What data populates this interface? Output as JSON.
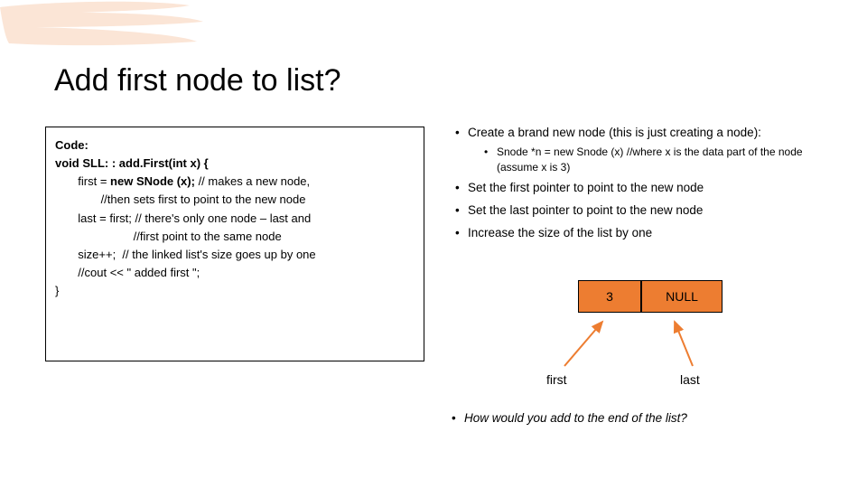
{
  "title": "Add first node to list?",
  "code": {
    "label": "Code:",
    "l1_a": "void SLL: : add.First(int x) {",
    "l2_a": "       first = ",
    "l2_b": "new SNode (x);",
    "l2_c": " // makes a new node,",
    "l3": "              //then sets first to point to the new node",
    "l4": "       last = first; // there's only one node – last and",
    "l5": "                        //first point to the same node",
    "l6": "       size++;  // the linked list's size goes up by one",
    "l7": "",
    "l8": "       //cout << \" added first \";",
    "l9": "}"
  },
  "bullets": {
    "b1": "Create a brand new node (this is just creating a node):",
    "b1_sub": "Snode *n = new Snode (x) //where x is the data part of the node (assume x is 3)",
    "b2": "Set the first pointer to point to the new node",
    "b3": "Set the last pointer to point to the new node",
    "b4": "Increase the size of the list by one"
  },
  "node": {
    "value": "3",
    "next": "NULL"
  },
  "ptr": {
    "first": "first",
    "last": "last"
  },
  "footer": "How would you add to the end of the list?"
}
